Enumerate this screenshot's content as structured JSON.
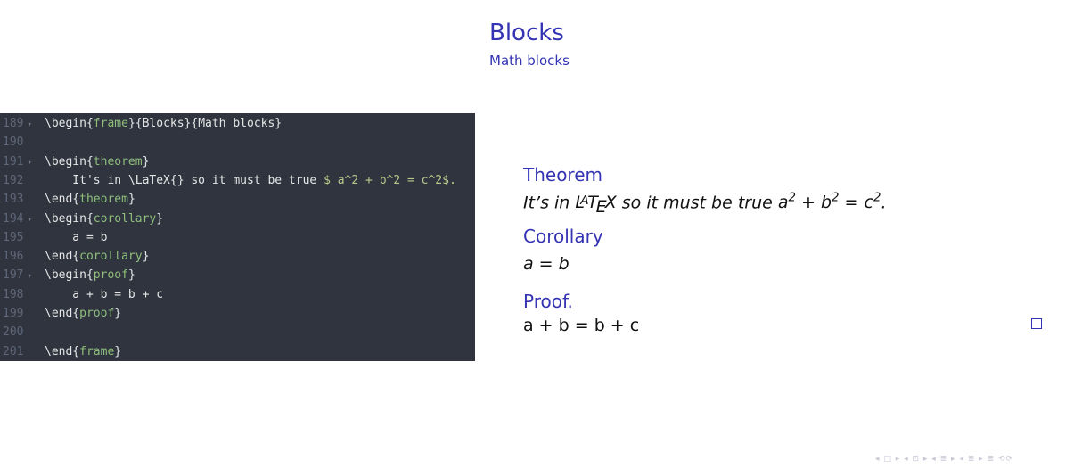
{
  "slide": {
    "title": "Blocks",
    "subtitle": "Math blocks"
  },
  "editor": {
    "lines": [
      {
        "num": "189",
        "fold": true,
        "parts": [
          [
            "kw",
            "\\begin{"
          ],
          [
            "env",
            "frame"
          ],
          [
            "kw",
            "}{Blocks}{Math blocks}"
          ]
        ]
      },
      {
        "num": "190",
        "fold": false,
        "parts": []
      },
      {
        "num": "191",
        "fold": true,
        "parts": [
          [
            "kw",
            "\\begin{"
          ],
          [
            "env",
            "theorem"
          ],
          [
            "kw",
            "}"
          ]
        ]
      },
      {
        "num": "192",
        "fold": false,
        "parts": [
          [
            "kw",
            "    It's in \\LaTeX{} so it must be true "
          ],
          [
            "math",
            "$ a^2 + b^2 = c^2$."
          ]
        ]
      },
      {
        "num": "193",
        "fold": false,
        "parts": [
          [
            "kw",
            "\\end{"
          ],
          [
            "env",
            "theorem"
          ],
          [
            "kw",
            "}"
          ]
        ]
      },
      {
        "num": "194",
        "fold": true,
        "parts": [
          [
            "kw",
            "\\begin{"
          ],
          [
            "env",
            "corollary"
          ],
          [
            "kw",
            "}"
          ]
        ]
      },
      {
        "num": "195",
        "fold": false,
        "parts": [
          [
            "kw",
            "    a = b"
          ]
        ]
      },
      {
        "num": "196",
        "fold": false,
        "parts": [
          [
            "kw",
            "\\end{"
          ],
          [
            "env",
            "corollary"
          ],
          [
            "kw",
            "}"
          ]
        ]
      },
      {
        "num": "197",
        "fold": true,
        "parts": [
          [
            "kw",
            "\\begin{"
          ],
          [
            "env",
            "proof"
          ],
          [
            "kw",
            "}"
          ]
        ]
      },
      {
        "num": "198",
        "fold": false,
        "parts": [
          [
            "kw",
            "    a + b = b + c"
          ]
        ]
      },
      {
        "num": "199",
        "fold": false,
        "parts": [
          [
            "kw",
            "\\end{"
          ],
          [
            "env",
            "proof"
          ],
          [
            "kw",
            "}"
          ]
        ]
      },
      {
        "num": "200",
        "fold": false,
        "parts": []
      },
      {
        "num": "201",
        "fold": false,
        "parts": [
          [
            "kw",
            "\\end{"
          ],
          [
            "env",
            "frame"
          ],
          [
            "kw",
            "}"
          ]
        ]
      }
    ]
  },
  "blocks": {
    "theorem": {
      "title": "Theorem",
      "text_before": "It’s in ",
      "text_after": " so it must be true ",
      "formula_tail": "."
    },
    "corollary": {
      "title": "Corollary",
      "body": "a = b"
    },
    "proof": {
      "title": "Proof.",
      "body": "a + b = b + c"
    }
  },
  "navigation": {
    "symbols": "◂ □ ▸ ◂ ⊡ ▸ ◂ ≣ ▸ ◂ ≣ ▸ ≣ ⟲⟳"
  },
  "colors": {
    "accent": "#3333b3",
    "editor_bg": "#2f343f"
  }
}
